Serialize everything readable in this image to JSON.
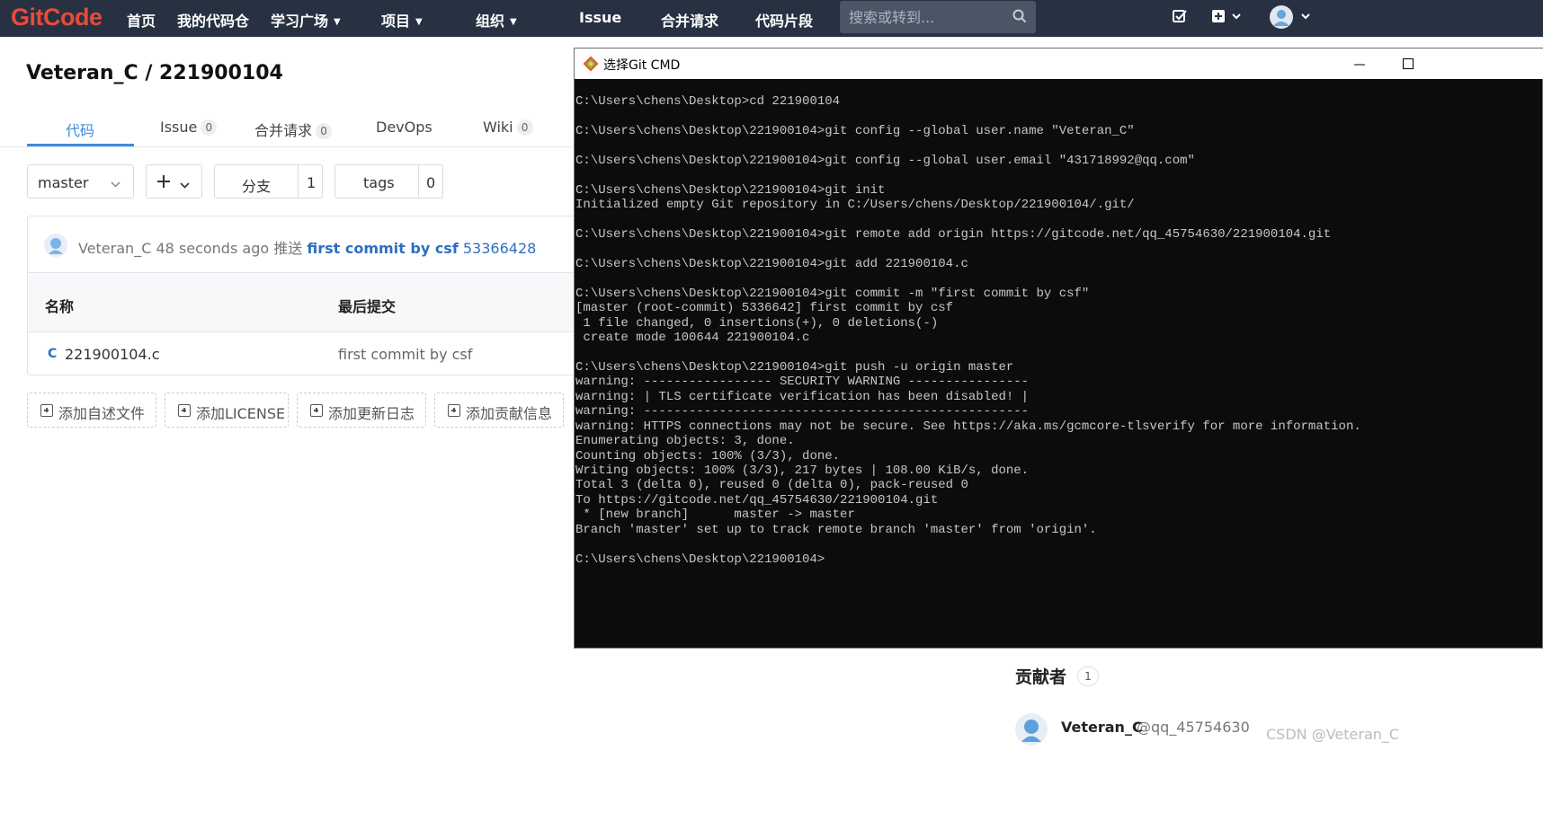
{
  "navbar": {
    "logo": "GitCode",
    "items": [
      {
        "label": "首页"
      },
      {
        "label": "我的代码仓"
      },
      {
        "label": "学习广场"
      },
      {
        "label": "项目"
      },
      {
        "label": "组织"
      },
      {
        "label": "Issue"
      },
      {
        "label": "合并请求"
      },
      {
        "label": "代码片段"
      }
    ],
    "search_placeholder": "搜索或转到..."
  },
  "project": {
    "title": "Veteran_C / 221900104"
  },
  "tabs": [
    {
      "label": "代码",
      "count": ""
    },
    {
      "label": "Issue",
      "count": "0"
    },
    {
      "label": "合并请求",
      "count": "0"
    },
    {
      "label": "DevOps",
      "count": ""
    },
    {
      "label": "Wiki",
      "count": "0"
    }
  ],
  "controls": {
    "branch": "master",
    "branches_label": "分支",
    "branches_count": "1",
    "tags_label": "tags",
    "tags_count": "0"
  },
  "commit": {
    "author": "Veteran_C",
    "time": "48 seconds ago",
    "action": "推送",
    "message": "first commit by csf",
    "hash": "53366428"
  },
  "file_table": {
    "headers": [
      "名称",
      "最后提交"
    ],
    "rows": [
      {
        "name": "221900104.c",
        "last_commit": "first commit by csf",
        "icon": "C"
      }
    ]
  },
  "add_buttons": [
    "添加自述文件",
    "添加LICENSE",
    "添加更新日志",
    "添加贡献信息"
  ],
  "contributors": {
    "title": "贡献者",
    "count": "1",
    "name": "Veteran_C",
    "handle": "@qq_45754630"
  },
  "watermark": "CSDN @Veteran_C",
  "cmd": {
    "title": "选择Git CMD",
    "lines": [
      "C:\\Users\\chens\\Desktop>cd 221900104",
      "",
      "C:\\Users\\chens\\Desktop\\221900104>git config --global user.name \"Veteran_C\"",
      "",
      "C:\\Users\\chens\\Desktop\\221900104>git config --global user.email \"431718992@qq.com\"",
      "",
      "C:\\Users\\chens\\Desktop\\221900104>git init",
      "Initialized empty Git repository in C:/Users/chens/Desktop/221900104/.git/",
      "",
      "C:\\Users\\chens\\Desktop\\221900104>git remote add origin https://gitcode.net/qq_45754630/221900104.git",
      "",
      "C:\\Users\\chens\\Desktop\\221900104>git add 221900104.c",
      "",
      "C:\\Users\\chens\\Desktop\\221900104>git commit -m \"first commit by csf\"",
      "[master (root-commit) 5336642] first commit by csf",
      " 1 file changed, 0 insertions(+), 0 deletions(-)",
      " create mode 100644 221900104.c",
      "",
      "C:\\Users\\chens\\Desktop\\221900104>git push -u origin master",
      "warning: ----------------- SECURITY WARNING ----------------",
      "warning: | TLS certificate verification has been disabled! |",
      "warning: ---------------------------------------------------",
      "warning: HTTPS connections may not be secure. See https://aka.ms/gcmcore-tlsverify for more information.",
      "Enumerating objects: 3, done.",
      "Counting objects: 100% (3/3), done.",
      "Writing objects: 100% (3/3), 217 bytes | 108.00 KiB/s, done.",
      "Total 3 (delta 0), reused 0 (delta 0), pack-reused 0",
      "To https://gitcode.net/qq_45754630/221900104.git",
      " * [new branch]      master -> master",
      "Branch 'master' set up to track remote branch 'master' from 'origin'.",
      "",
      "C:\\Users\\chens\\Desktop\\221900104>"
    ]
  },
  "colors": {
    "navbar_bg": "#273142",
    "logo": "#e74b3c",
    "accent": "#3b8bdc",
    "link": "#2c6fc4",
    "terminal_bg": "#0c0c0c",
    "terminal_fg": "#c6c6c6"
  }
}
